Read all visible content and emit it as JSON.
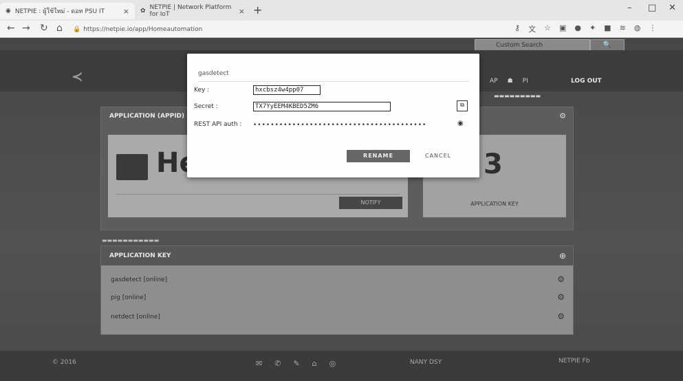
{
  "browser": {
    "tabs": [
      {
        "label": "NETPIE : ผู้ใช้ใหม่ - ดอท PSU IT"
      },
      {
        "label": "NETPIE | Network Platform for IoT"
      }
    ],
    "url": "https://netpie.io/app/Homeautomation",
    "window_controls": [
      "–",
      "□",
      "✕"
    ]
  },
  "page": {
    "search": {
      "placeholder": "Custom Search",
      "button": "🔍"
    },
    "nav": {
      "items": [
        "AP",
        "",
        "PI"
      ],
      "logout": "LOG OUT"
    },
    "app_panel": {
      "title": "APPLICATION (APPID)",
      "card_title": "He",
      "notify_label": "NOTIFY",
      "card_number": "3",
      "card_right_label": "APPLICATION KEY"
    },
    "keys_panel": {
      "title": "APPLICATION KEY",
      "rows": [
        {
          "label": "gasdetect [online]"
        },
        {
          "label": "pig [online]"
        },
        {
          "label": "netdect [online]"
        }
      ]
    },
    "footer": {
      "left": "© 2016",
      "mid": "NANY  DSY",
      "right": "NETPIE  Fb"
    }
  },
  "modal": {
    "app_name": "gasdetect",
    "key_label": "Key :",
    "key_value": "hxcbsz4w4pp07",
    "secret_label": "Secret :",
    "secret_value": "TX7YyEEM4KBED5ZM6",
    "rest_label": "REST API auth :",
    "rest_value": "••••••••••••••••••••••••••••••••••••••••",
    "rename_label": "RENAME",
    "cancel_label": "CANCEL"
  },
  "icons": {
    "back": "back-arrow-icon",
    "forward": "forward-arrow-icon",
    "reload": "reload-icon",
    "home": "home-icon",
    "lock": "lock-icon",
    "copy": "copy-icon",
    "eye": "eye-icon",
    "gear": "gear-icon",
    "add": "add-icon"
  }
}
